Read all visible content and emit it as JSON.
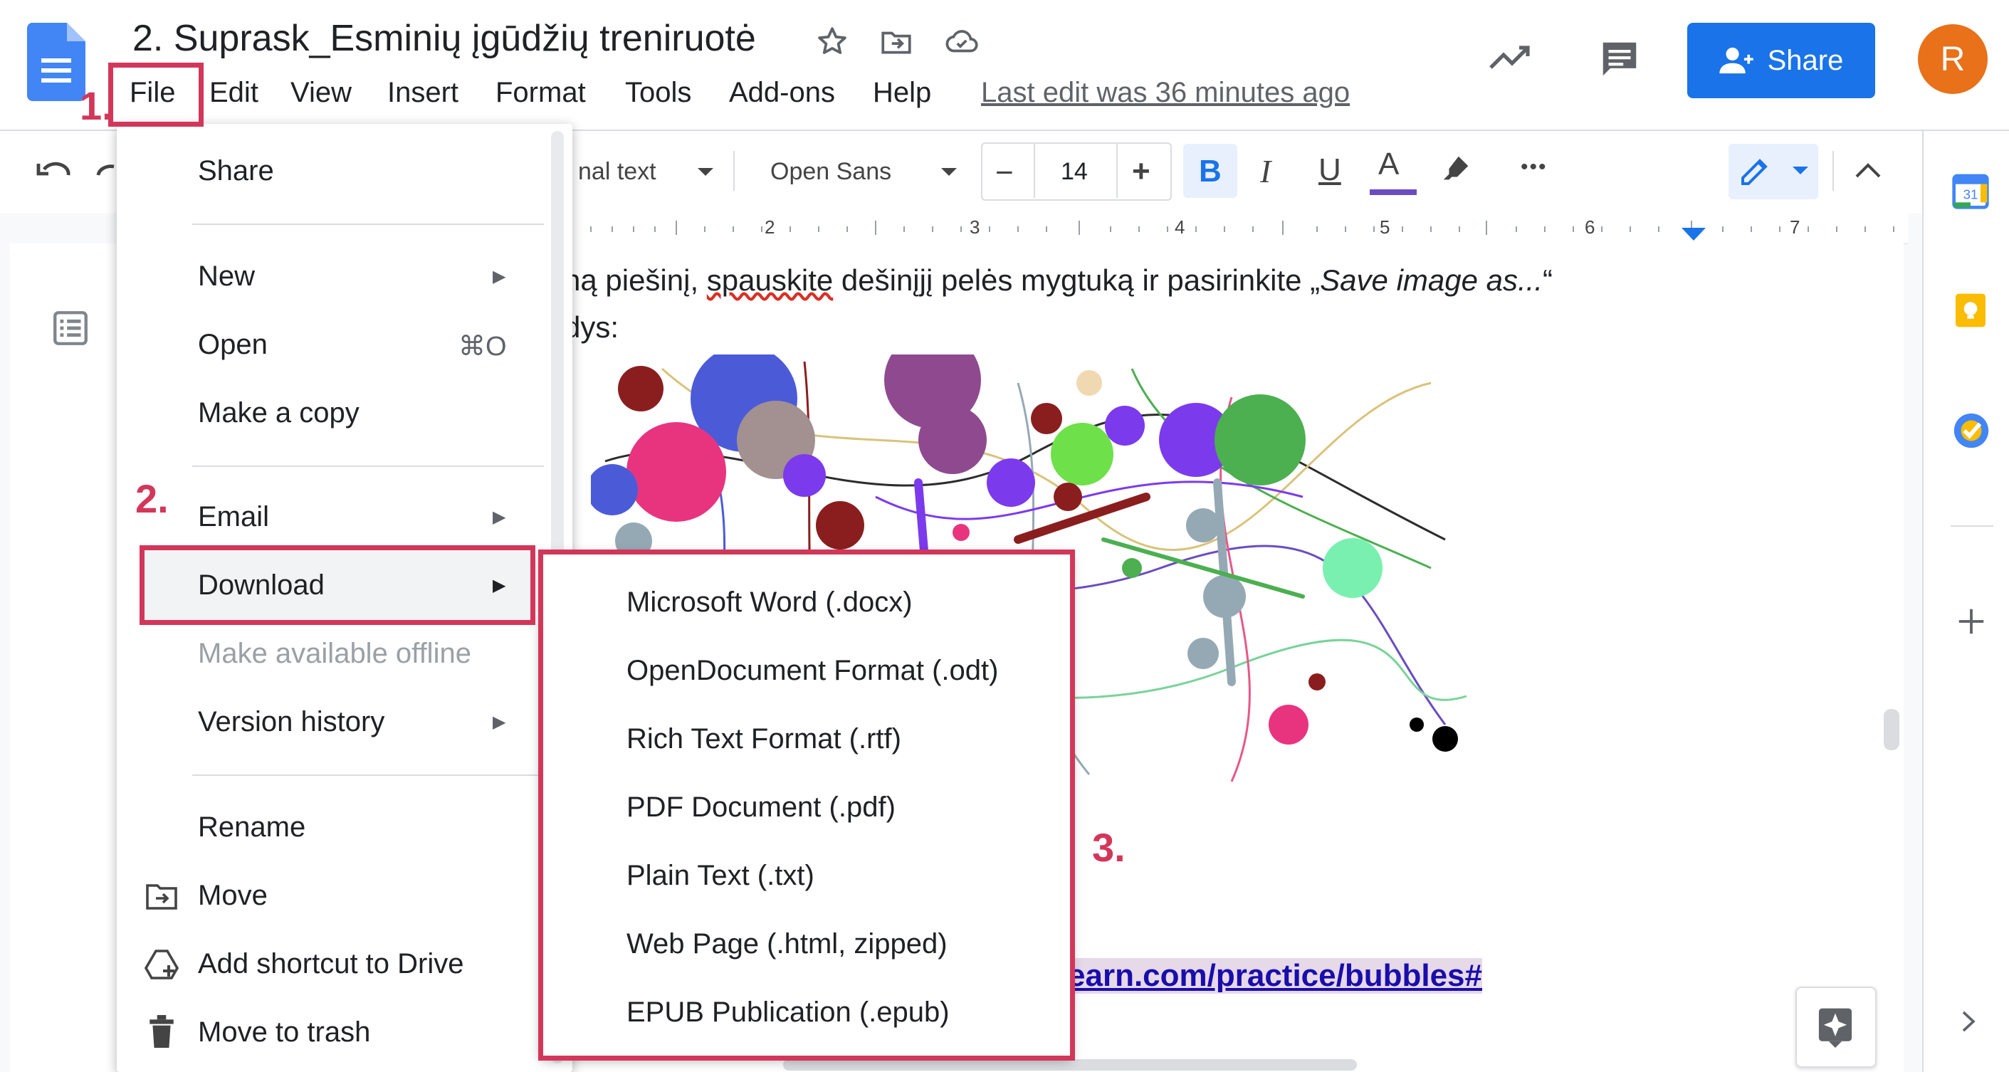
{
  "doc": {
    "title": "2. Suprask_Esminių įgūdžių treniruotė",
    "last_edit": "Last edit was 36 minutes ago",
    "share_label": "Share",
    "avatar_initial": "R"
  },
  "menubar": [
    "File",
    "Edit",
    "View",
    "Insert",
    "Format",
    "Tools",
    "Add-ons",
    "Help"
  ],
  "toolbar": {
    "style": "nal text",
    "font": "Open Sans",
    "font_size": "14",
    "bold": "B",
    "italic": "I",
    "underline": "U",
    "text_color": "A",
    "more": "•••"
  },
  "ruler": [
    "2",
    "3",
    "4",
    "5",
    "6",
    "7"
  ],
  "body": {
    "line1_prefix": "ną piešinį, ",
    "line1_misspelled": "spauskite",
    "line1_rest": " dešinįjį pelės mygtuką ir pasirinkite „",
    "line1_italic": "Save image as...",
    "line1_close": "“",
    "line2": "dys:",
    "link": "earn.com/practice/bubbles#"
  },
  "file_menu": {
    "share": "Share",
    "new": "New",
    "open": "Open",
    "open_shortcut": "⌘O",
    "make_copy": "Make a copy",
    "email": "Email",
    "download": "Download",
    "offline": "Make available offline",
    "version_history": "Version history",
    "rename": "Rename",
    "move": "Move",
    "add_shortcut": "Add shortcut to Drive",
    "trash": "Move to trash"
  },
  "download_menu": [
    "Microsoft Word (.docx)",
    "OpenDocument Format (.odt)",
    "Rich Text Format (.rtf)",
    "PDF Document (.pdf)",
    "Plain Text (.txt)",
    "Web Page (.html, zipped)",
    "EPUB Publication (.epub)"
  ],
  "annotations": {
    "step1": "1.",
    "step2": "2.",
    "step3": "3.",
    "color": "#d2375a"
  },
  "side": {
    "calendar_day": "31"
  }
}
